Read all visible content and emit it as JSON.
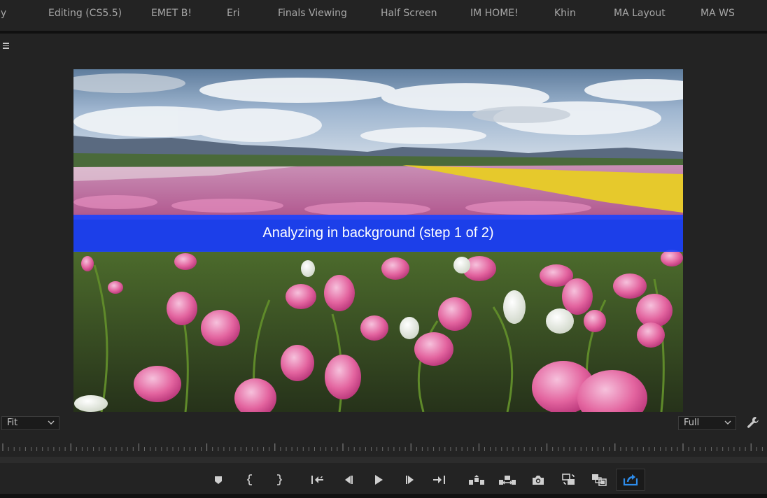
{
  "workspaces": [
    {
      "label": "py",
      "active": false
    },
    {
      "label": "Editing (CS5.5)",
      "active": false
    },
    {
      "label": "EMET B!",
      "active": false
    },
    {
      "label": "Eri",
      "active": false
    },
    {
      "label": "Finals Viewing",
      "active": false
    },
    {
      "label": "Half Screen",
      "active": false
    },
    {
      "label": "IM HOME!",
      "active": false
    },
    {
      "label": "Khin",
      "active": false
    },
    {
      "label": "MA Layout",
      "active": false
    },
    {
      "label": "MA WS",
      "active": false
    }
  ],
  "monitor": {
    "overlay_text": "Analyzing in background (step 1 of 2)",
    "zoom_select": "Fit",
    "resolution_select": "Full",
    "accent_color": "#1c42ff"
  },
  "transport": {
    "buttons": [
      {
        "icon": "marker-icon",
        "name": "add-marker-button"
      },
      {
        "icon": "mark-in-icon",
        "name": "mark-in-button"
      },
      {
        "icon": "mark-out-icon",
        "name": "mark-out-button"
      },
      {
        "icon": "go-to-in-icon",
        "name": "go-to-in-button"
      },
      {
        "icon": "step-back-icon",
        "name": "step-back-button"
      },
      {
        "icon": "play-icon",
        "name": "play-button"
      },
      {
        "icon": "step-forward-icon",
        "name": "step-forward-button"
      },
      {
        "icon": "go-to-out-icon",
        "name": "go-to-out-button"
      },
      {
        "icon": "lift-icon",
        "name": "lift-button"
      },
      {
        "icon": "extract-icon",
        "name": "extract-button"
      },
      {
        "icon": "camera-icon",
        "name": "export-frame-button"
      },
      {
        "icon": "comparison-view-icon",
        "name": "comparison-view-button"
      },
      {
        "icon": "multi-camera-icon",
        "name": "toggle-proxies-button"
      },
      {
        "icon": "export-icon",
        "name": "export-button"
      }
    ],
    "active_button": "export-button",
    "active_color": "#2d8ceb"
  }
}
